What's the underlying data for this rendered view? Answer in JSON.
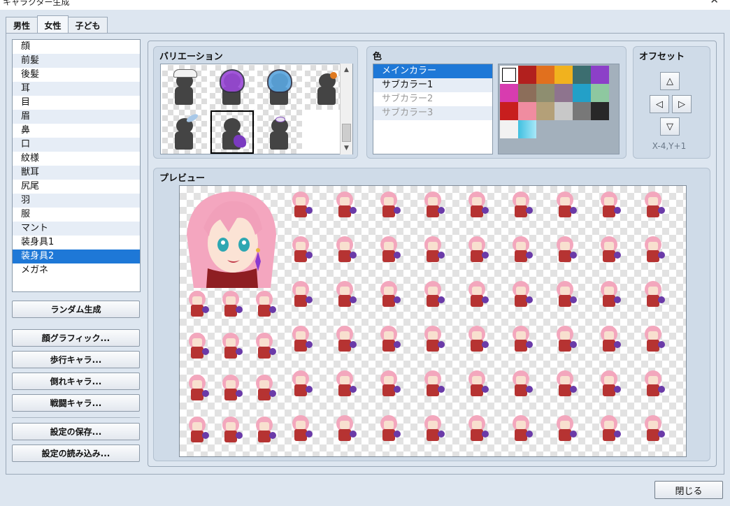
{
  "window": {
    "title": "キャラクター生成",
    "close_glyph": "✕"
  },
  "tabs": [
    {
      "label": "男性"
    },
    {
      "label": "女性"
    },
    {
      "label": "子ども"
    }
  ],
  "active_tab": "女性",
  "parts": [
    "顔",
    "前髪",
    "後髪",
    "耳",
    "目",
    "眉",
    "鼻",
    "口",
    "紋様",
    "獣耳",
    "尻尾",
    "羽",
    "服",
    "マント",
    "装身具1",
    "装身具2",
    "メガネ"
  ],
  "selected_part": "装身具2",
  "buttons": {
    "random": "ランダム生成",
    "face": "顔グラフィック...",
    "walk": "歩行キャラ...",
    "down": "倒れキャラ...",
    "battle": "戦闘キャラ...",
    "save": "設定の保存...",
    "load": "設定の読み込み...",
    "close": "閉じる"
  },
  "variation": {
    "title": "バリエーション",
    "selected_index": 5,
    "scroll_up_glyph": "▲",
    "scroll_down_glyph": "▼"
  },
  "color": {
    "title": "色",
    "items": [
      {
        "label": "メインカラー",
        "state": "selected"
      },
      {
        "label": "サブカラー1",
        "state": "enabled"
      },
      {
        "label": "サブカラー2",
        "state": "disabled"
      },
      {
        "label": "サブカラー3",
        "state": "disabled"
      }
    ],
    "swatches": [
      "#ffffff",
      "#b2201e",
      "#e1701e",
      "#f1b21e",
      "#3c6e70",
      "#8c40c8",
      "#d83caf",
      "#8c6e5a",
      "#8e8e70",
      "#8e748e",
      "#23a0c8",
      "#8ec8a0",
      "#c81e1e",
      "#f08ca0",
      "#b4a078",
      "#c8c8c8",
      "#787878",
      "#282828",
      "#f2f2f2",
      "#40c0e0"
    ],
    "selected_swatch": 0
  },
  "offset": {
    "title": "オフセット",
    "up": "△",
    "left": "◁",
    "right": "▷",
    "down": "▽",
    "value": "X-4,Y+1"
  },
  "preview": {
    "title": "プレビュー"
  }
}
